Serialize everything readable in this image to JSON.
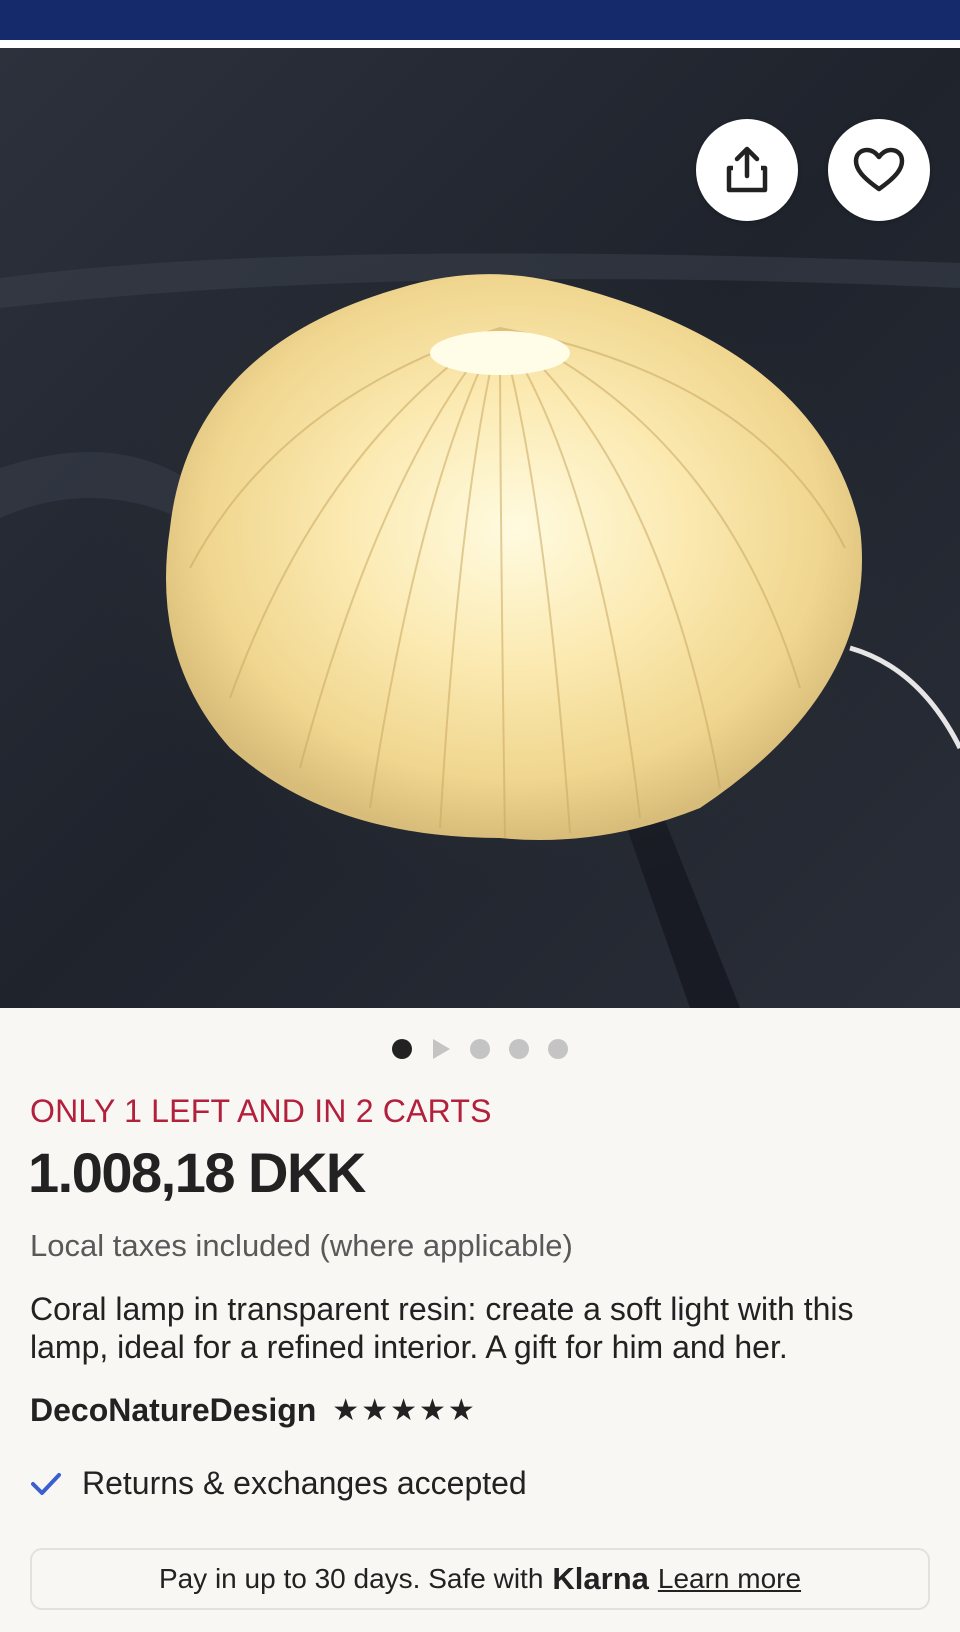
{
  "header": {
    "brand_color": "#142a6b"
  },
  "gallery": {
    "image_name": "coral-lamp-photo",
    "share_icon": "share-icon",
    "favorite_icon": "heart-icon",
    "dots": [
      "active",
      "video",
      "inactive",
      "inactive",
      "inactive"
    ]
  },
  "listing": {
    "stock_notice": "ONLY 1 LEFT AND IN 2 CARTS",
    "stock_color": "#b2203c",
    "price": "1.008,18 DKK",
    "taxes_note": "Local taxes included (where applicable)",
    "title": "Coral lamp in transparent resin: create a soft light with this lamp, ideal for a refined interior. A gift for him and her.",
    "shop_name": "DecoNatureDesign",
    "rating_stars": "★★★★★",
    "rating_value": 5,
    "returns_text": "Returns & exchanges accepted",
    "returns_icon": "checkmark-icon",
    "check_color": "#3b5fcf"
  },
  "klarna": {
    "text": "Pay in up to 30 days. Safe with",
    "brand": "Klarna",
    "link": "Learn more"
  }
}
